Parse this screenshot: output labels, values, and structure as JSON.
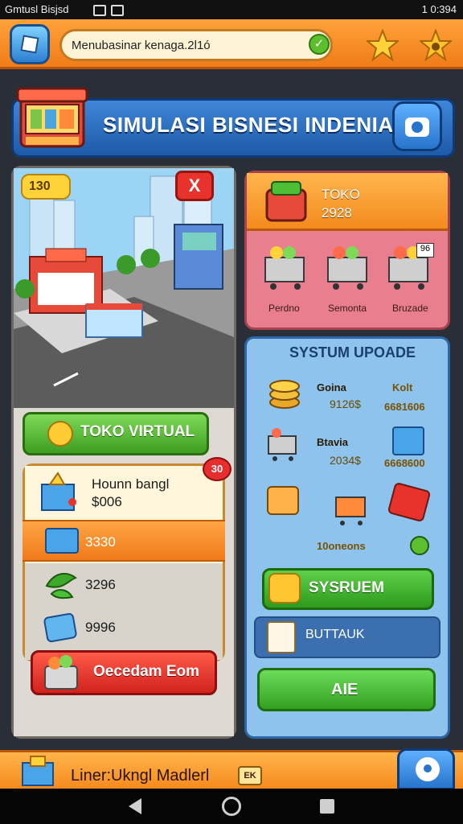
{
  "status_bar": {
    "left_text": "Gmtusl Bisjsd",
    "right_text": "1 0:394"
  },
  "top_bar": {
    "field_text": "Menubasinar kenaga.2l1ó",
    "icons": [
      "cube-logo-icon",
      "check-icon",
      "star-icon",
      "star-badge-icon"
    ]
  },
  "header": {
    "title": "SIMULASI BISNESI INDENIAS",
    "icons": [
      "shop-icon",
      "camera-icon"
    ]
  },
  "city_view": {
    "coin_badge": "130",
    "close_label": "X"
  },
  "toko_button": {
    "label": "TOKO VIRTUAL"
  },
  "item_card": {
    "name": "Hounn bangl",
    "price": "$006",
    "discount": "30",
    "rows": [
      {
        "icon": "blue-box-icon",
        "value": "3330"
      },
      {
        "icon": "leaf-icon",
        "value": "3296"
      },
      {
        "icon": "blue-cube-icon",
        "value": "9996"
      }
    ]
  },
  "red_button": {
    "label": "Oecedam Eom"
  },
  "toko_card": {
    "label": "TOKO",
    "value": "2928",
    "carts": [
      {
        "label": "Perdno"
      },
      {
        "label": "Semonta",
        "badge": ""
      },
      {
        "label": "Bruzade",
        "badge": "96"
      }
    ]
  },
  "upgrade_panel": {
    "title": "SYSTUM UPOADE",
    "rows": [
      {
        "name": "Goina",
        "value": "9126$",
        "right_value": "6681606",
        "right_badge": "Kolt"
      },
      {
        "name": "Btavia",
        "value": "2034$",
        "right_value": "6668600"
      },
      {
        "name": "",
        "value": "10oneons",
        "right_value": ""
      }
    ],
    "green_button_label": "SYSRUEM",
    "blue_row_label": "BUTTAUK",
    "bottom_button_label": "AIE"
  },
  "bottom_bar": {
    "label": "Liner:Ukngl Madlerl",
    "badge": "EK"
  },
  "colors": {
    "orange": "#f58a1e",
    "blue": "#1e5aa8",
    "green": "#3e9e22",
    "red": "#d0231d",
    "panel_blue": "#8ec3ee",
    "pink": "#e97e8e"
  }
}
